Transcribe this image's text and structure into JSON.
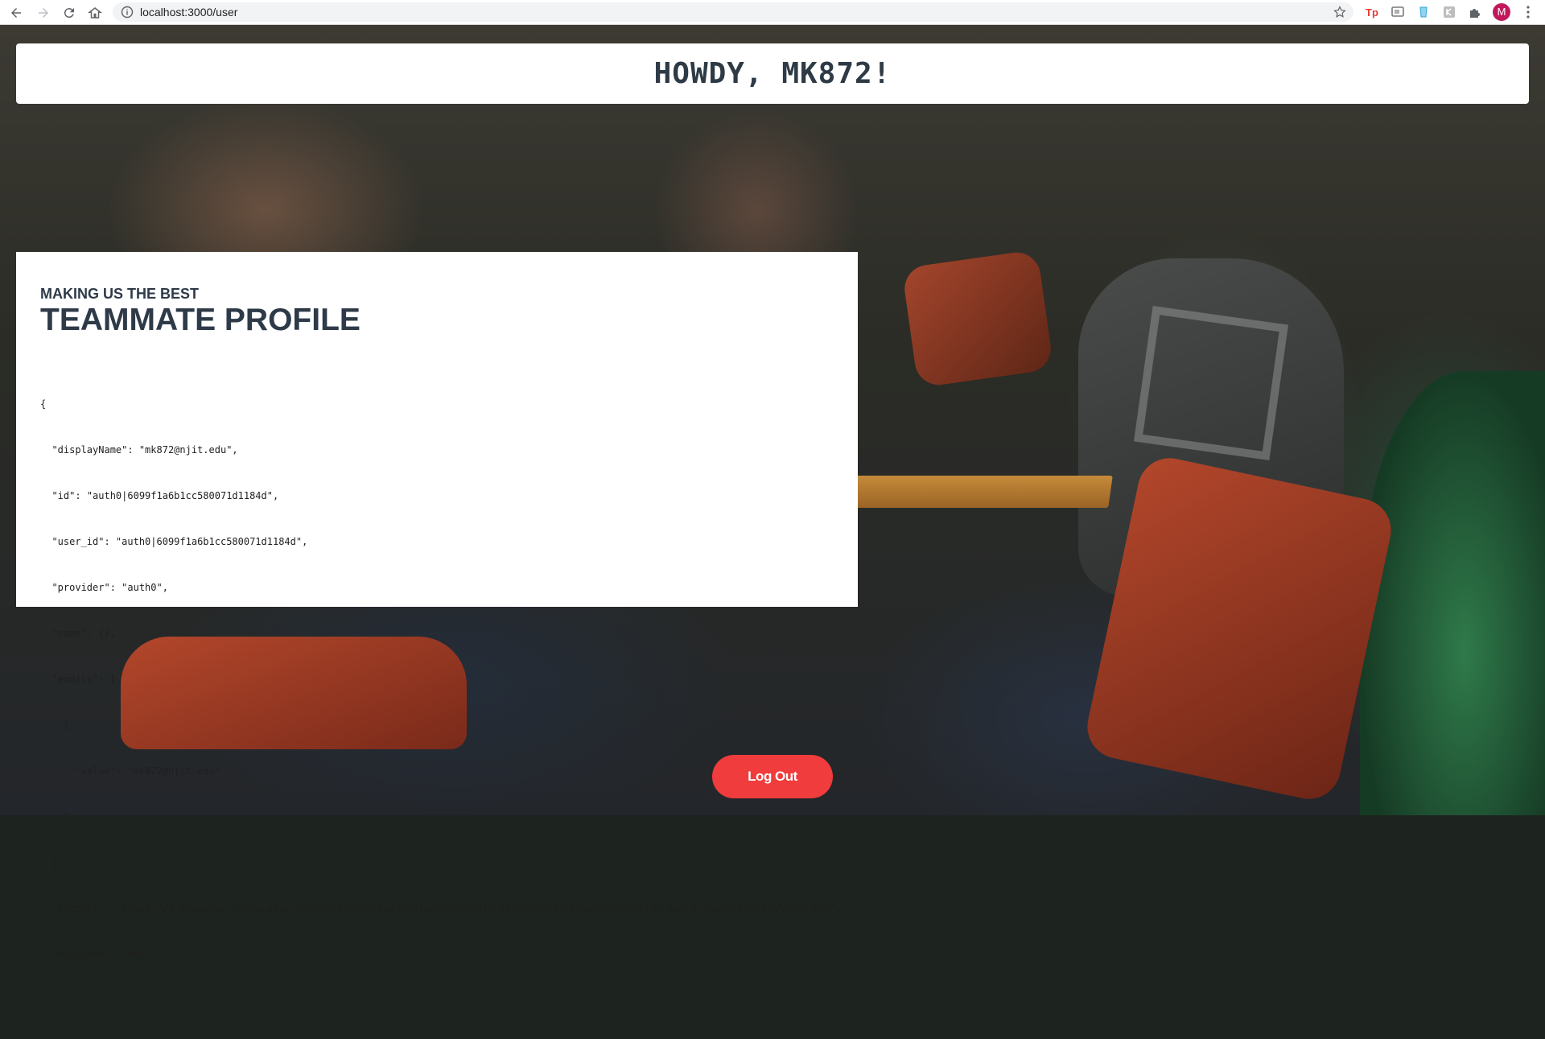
{
  "browser": {
    "url": "localhost:3000/user",
    "profile_initial": "M",
    "extensions": [
      "tp-extension-icon",
      "cast-icon",
      "cup-extension-icon",
      "grey-extension-icon",
      "puzzle-icon"
    ]
  },
  "header": {
    "greeting": "HOWDY, MK872!"
  },
  "profile": {
    "eyebrow": "MAKING US THE BEST",
    "title": "TEAMMATE PROFILE",
    "json_lines": [
      "{",
      "  \"displayName\": \"mk872@njit.edu\",",
      "  \"id\": \"auth0|6099f1a6b1cc580071d1184d\",",
      "  \"user_id\": \"auth0|6099f1a6b1cc580071d1184d\",",
      "  \"provider\": \"auth0\",",
      "  \"name\": {},",
      "  \"emails\": [",
      "    {",
      "      \"value\": \"mk872@njit.edu\"",
      "    }",
      "  ],",
      "  \"picture\": \"https://s.gravatar.com/avatar/688dc98e23d28fbeddf85fed373d4be8?s=480&r=pg&d=https%3A%2F%2Fcdn.auth0.com%2Favatars%2Fmk.png\",",
      "  \"nickname\": \"mk872\"",
      "}"
    ]
  },
  "actions": {
    "logout_label": "Log Out",
    "logout_color": "#f03c3c"
  }
}
